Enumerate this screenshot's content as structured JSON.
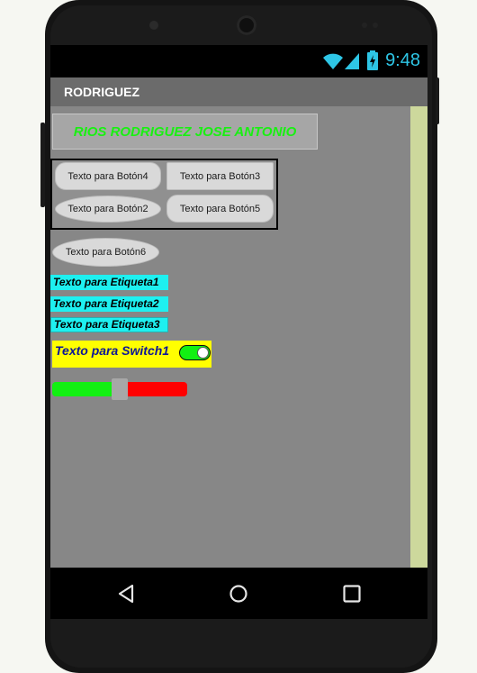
{
  "status_bar": {
    "time": "9:48",
    "accent_color": "#2ec6e6",
    "icons": [
      "wifi-icon",
      "signal-icon",
      "battery-icon"
    ]
  },
  "app": {
    "title": "RODRIGUEZ"
  },
  "name_label": {
    "text": "RIOS RODRIGUEZ JOSE ANTONIO",
    "color": "#19f012"
  },
  "buttons": {
    "b4": "Texto para Botón4",
    "b3": "Texto para Botón3",
    "b2": "Texto para Botón2",
    "b5": "Texto para Botón5",
    "b6": "Texto para Botón6"
  },
  "labels": {
    "l1": "Texto para Etiqueta1",
    "l2": "Texto para Etiqueta2",
    "l3": "Texto para Etiqueta3",
    "background_color": "#1ef0f0"
  },
  "switch": {
    "text": "Texto para Switch1",
    "on": true,
    "background_color": "#ffff00",
    "text_color": "#0c1696"
  },
  "slider": {
    "value_fraction": 0.5,
    "left_color": "#12f012",
    "right_color": "#ff0000"
  },
  "nav": {
    "icons": [
      "back-icon",
      "home-icon",
      "recents-icon"
    ]
  }
}
